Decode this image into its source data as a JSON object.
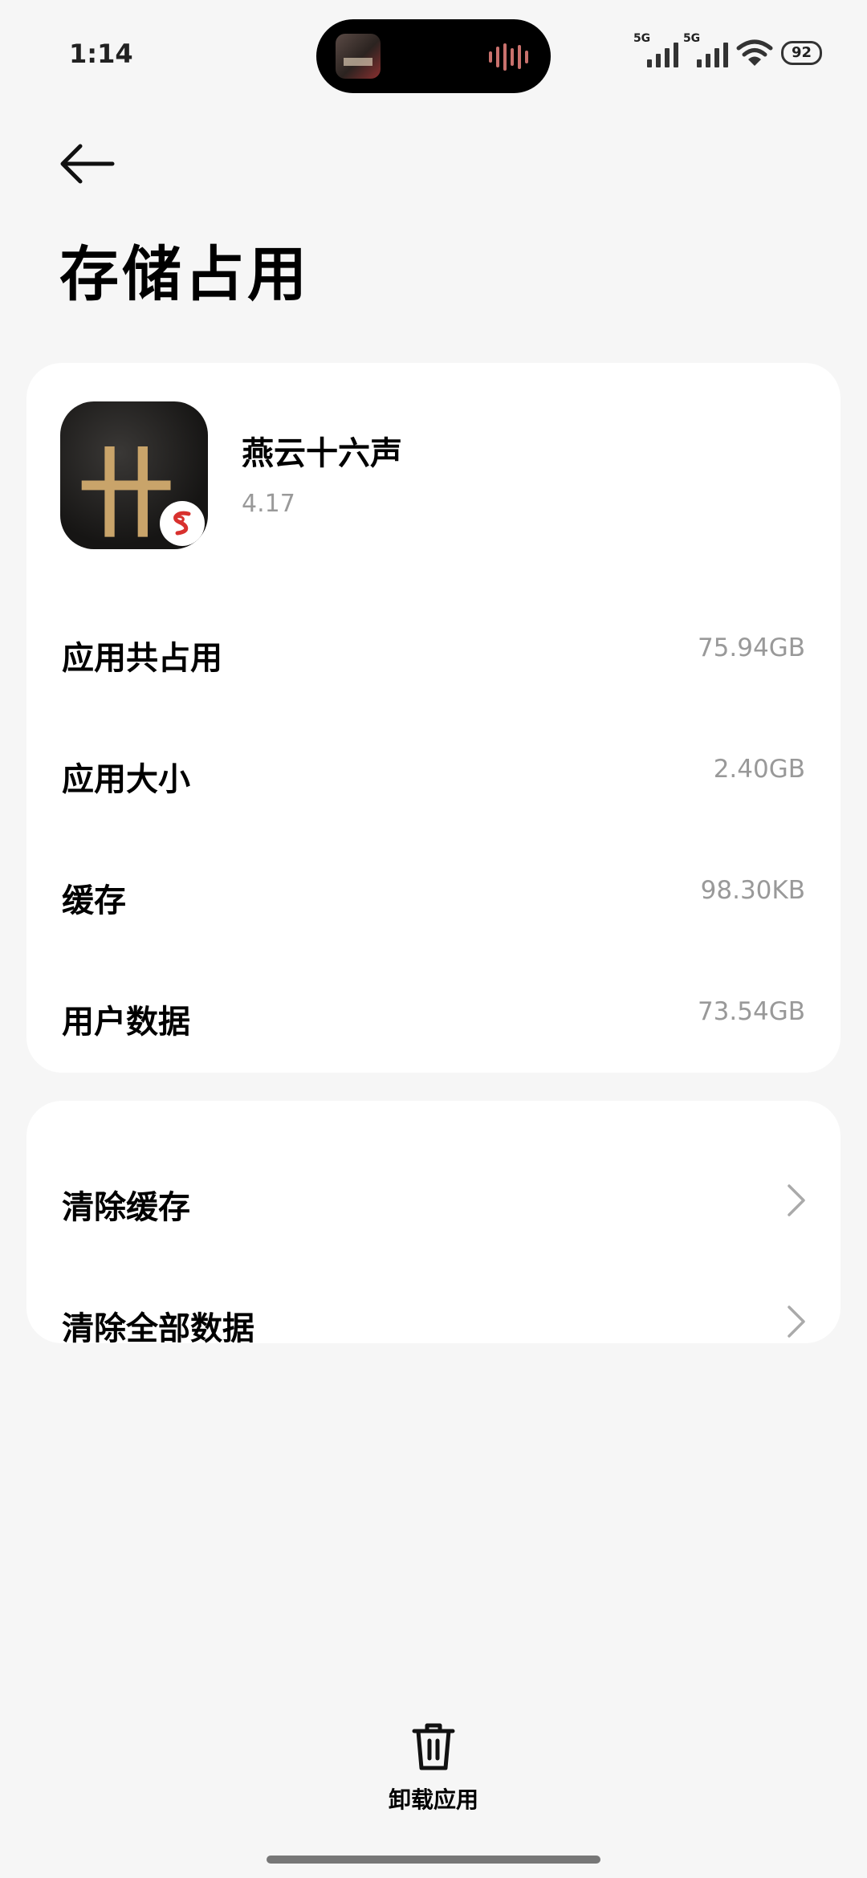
{
  "status_bar": {
    "time": "1:14",
    "sim1": "5G",
    "sim2": "5G",
    "battery": "92"
  },
  "header": {
    "title": "存储占用"
  },
  "app": {
    "name": "燕云十六声",
    "version": "4.17",
    "icon_text": "卄"
  },
  "storage": [
    {
      "label": "应用共占用",
      "value": "75.94GB"
    },
    {
      "label": "应用大小",
      "value": "2.40GB"
    },
    {
      "label": "缓存",
      "value": "98.30KB"
    },
    {
      "label": "用户数据",
      "value": "73.54GB"
    }
  ],
  "actions": [
    {
      "label": "清除缓存"
    },
    {
      "label": "清除全部数据"
    }
  ],
  "bottom": {
    "uninstall_label": "卸载应用"
  },
  "colors": {
    "background": "#f6f6f6",
    "card": "#ffffff",
    "secondary_text": "#999999",
    "icon_gold": "#c9a46a",
    "netease_red": "#d8312e"
  }
}
